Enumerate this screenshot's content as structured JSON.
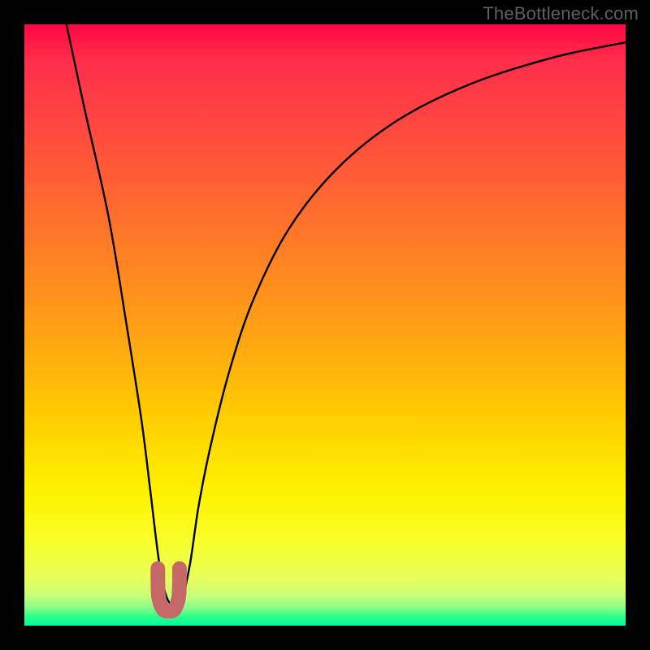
{
  "watermark": "TheBottleneck.com",
  "chart_data": {
    "type": "line",
    "title": "",
    "xlabel": "",
    "ylabel": "",
    "xlim": [
      0,
      100
    ],
    "ylim": [
      0,
      100
    ],
    "grid": false,
    "legend": false,
    "gradient_scale": {
      "y_top_color": "#ff0744",
      "y_bottom_color": "#00ff99",
      "meaning": "low values green (good), high values red (bad)"
    },
    "series": [
      {
        "name": "bottleneck-curve",
        "color": "#000000",
        "x": [
          7,
          10,
          14,
          17,
          19.5,
          21,
          22.5,
          24,
          26,
          27.5,
          29,
          31,
          34,
          38,
          44,
          52,
          62,
          74,
          88,
          100
        ],
        "y": [
          100,
          86,
          68,
          50,
          34,
          22,
          10,
          4,
          4,
          10,
          20,
          30,
          42,
          54,
          66,
          76,
          84,
          90,
          94.5,
          97
        ]
      },
      {
        "name": "valley-marker",
        "color": "#c76868",
        "shape": "rounded-U",
        "x": [
          22.2,
          22.3,
          23.0,
          24.0,
          25.0,
          25.7,
          25.8
        ],
        "y": [
          9.5,
          5.0,
          2.8,
          2.4,
          2.8,
          5.0,
          9.5
        ]
      }
    ],
    "minimum_point": {
      "x": 24,
      "y": 2.4
    }
  }
}
